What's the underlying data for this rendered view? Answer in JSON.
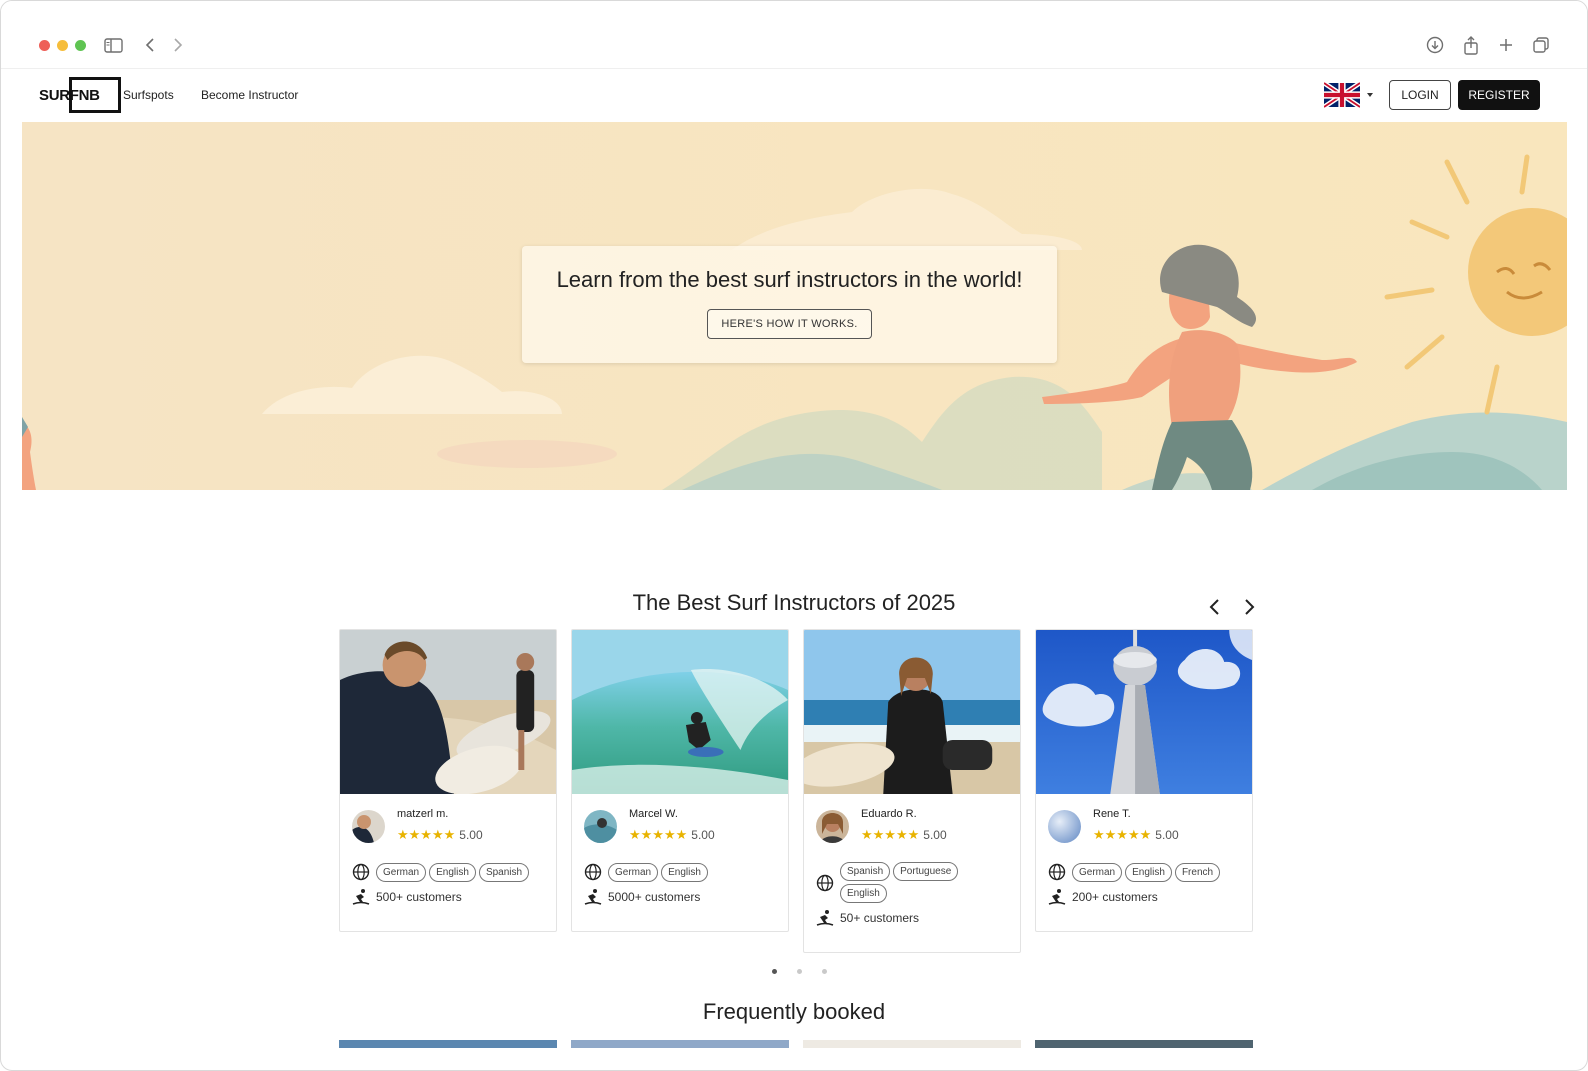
{
  "nav": {
    "logo": "SURFNB",
    "links": [
      "Surfspots",
      "Become Instructor"
    ],
    "login": "LOGIN",
    "register": "REGISTER"
  },
  "hero": {
    "title": "Learn from the best surf instructors in the world!",
    "cta": "HERE'S HOW IT WORKS."
  },
  "instructors": {
    "title": "The Best Surf Instructors of 2025",
    "items": [
      {
        "name": "matzerl m.",
        "rating": "5.00",
        "stars": "★★★★★",
        "languages": [
          "German",
          "English",
          "Spanish"
        ],
        "customers": "500+ customers"
      },
      {
        "name": "Marcel W.",
        "rating": "5.00",
        "stars": "★★★★★",
        "languages": [
          "German",
          "English"
        ],
        "customers": "5000+ customers"
      },
      {
        "name": "Eduardo R.",
        "rating": "5.00",
        "stars": "★★★★★",
        "languages": [
          "Spanish",
          "Portuguese",
          "English"
        ],
        "customers": "50+ customers"
      },
      {
        "name": "Rene T.",
        "rating": "5.00",
        "stars": "★★★★★",
        "languages": [
          "German",
          "English",
          "French"
        ],
        "customers": "200+ customers"
      }
    ],
    "pager": {
      "count": 3,
      "active": 0
    }
  },
  "frequently": {
    "title": "Frequently booked"
  },
  "colors": {
    "accent": "#111111",
    "star": "#e8b300",
    "hero_bg": "#f8e6c3"
  }
}
